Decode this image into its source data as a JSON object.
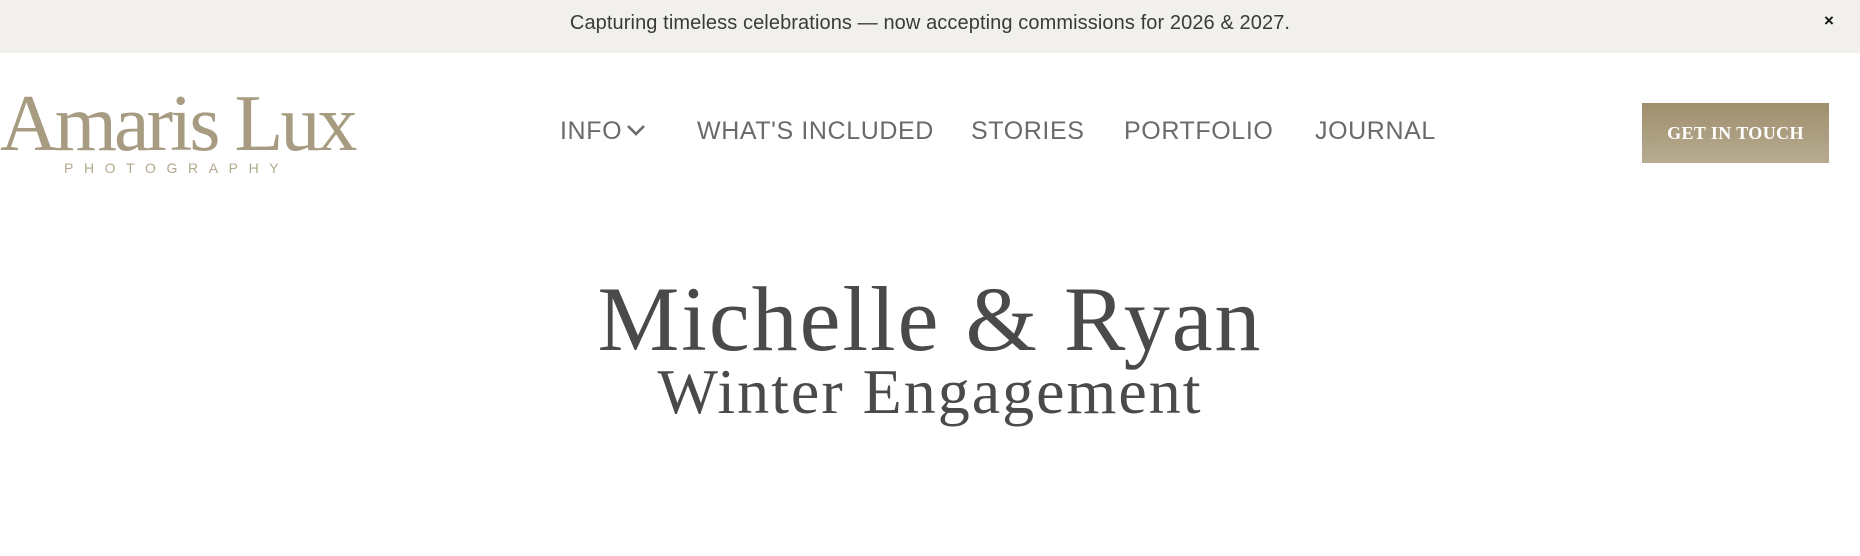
{
  "announcement": {
    "text": "Capturing timeless celebrations — now accepting commissions for 2026 & 2027.",
    "close_glyph": "×"
  },
  "header": {
    "logo": {
      "name": "Amaris Lux",
      "tagline": "PHOTOGRAPHY"
    },
    "nav": [
      {
        "label": "INFO",
        "has_dropdown": true,
        "icon": "chevron-down-icon"
      },
      {
        "label": "WHAT'S INCLUDED"
      },
      {
        "label": "STORIES"
      },
      {
        "label": "PORTFOLIO"
      },
      {
        "label": "JOURNAL"
      }
    ],
    "cta_label": "GET IN TOUCH"
  },
  "hero": {
    "title": "Michelle & Ryan",
    "subtitle": "Winter Engagement"
  },
  "colors": {
    "brand": "#a79c82",
    "announcement_bg": "#f1f0ec",
    "cta_top": "#9e8f6d",
    "cta_bottom": "#b7ab90",
    "text": "#4a4a4a",
    "nav_text": "#6a6a6a"
  }
}
